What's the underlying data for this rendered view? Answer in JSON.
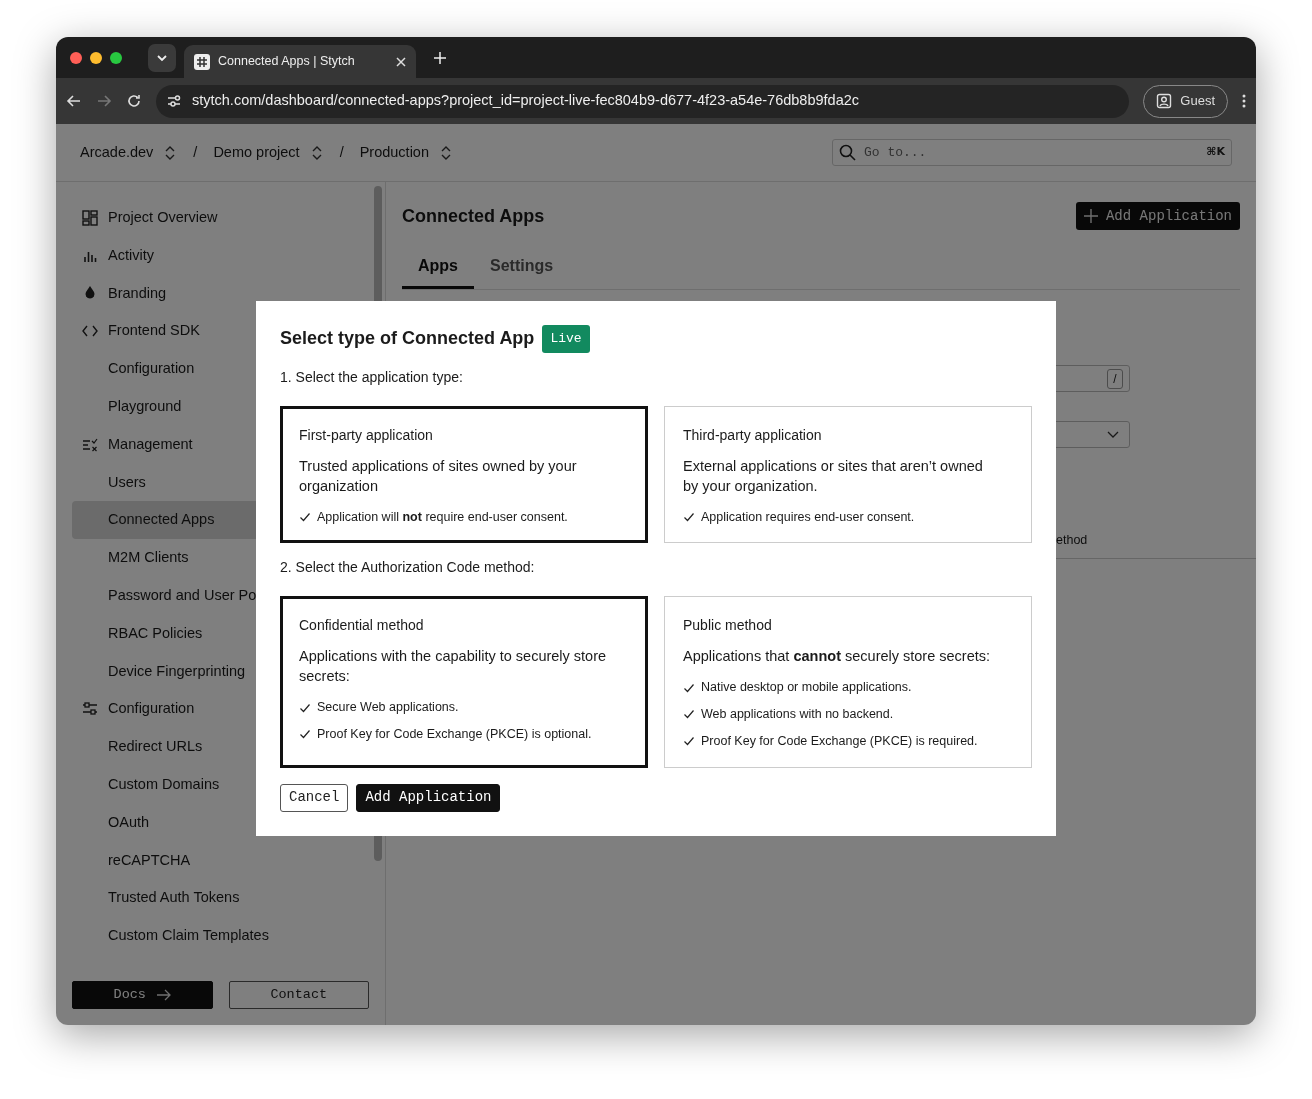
{
  "browser": {
    "tab_title": "Connected Apps | Stytch",
    "url": "stytch.com/dashboard/connected-apps?project_id=project-live-fec804b9-d677-4f23-a54e-76db8b9fda2c",
    "profile": "Guest"
  },
  "header": {
    "breadcrumbs": [
      {
        "kind": "crumb",
        "label": "Arcade.dev"
      },
      {
        "kind": "separator",
        "label": "/"
      },
      {
        "kind": "crumb",
        "label": "Demo project"
      },
      {
        "kind": "separator",
        "label": "/"
      },
      {
        "kind": "crumb",
        "label": "Production"
      }
    ],
    "search": {
      "placeholder": "Go to...",
      "shortcut": "⌘K"
    }
  },
  "sidebar": {
    "items": [
      {
        "kind": "section",
        "label": "Project Overview",
        "selected": false
      },
      {
        "kind": "section",
        "label": "Activity",
        "selected": false
      },
      {
        "kind": "section",
        "label": "Branding",
        "selected": false
      },
      {
        "kind": "section",
        "label": "Frontend SDK",
        "selected": false
      },
      {
        "kind": "sub",
        "label": "Configuration",
        "selected": false
      },
      {
        "kind": "sub",
        "label": "Playground",
        "selected": false
      },
      {
        "kind": "section",
        "label": "Management",
        "selected": false
      },
      {
        "kind": "sub",
        "label": "Users",
        "selected": false
      },
      {
        "kind": "sub",
        "label": "Connected Apps",
        "selected": true
      },
      {
        "kind": "sub",
        "label": "M2M Clients",
        "selected": false
      },
      {
        "kind": "sub",
        "label": "Password and User Po",
        "selected": false
      },
      {
        "kind": "sub",
        "label": "RBAC Policies",
        "selected": false
      },
      {
        "kind": "sub",
        "label": "Device Fingerprinting",
        "selected": false
      },
      {
        "kind": "section",
        "label": "Configuration",
        "selected": false
      },
      {
        "kind": "sub",
        "label": "Redirect URLs",
        "selected": false
      },
      {
        "kind": "sub",
        "label": "Custom Domains",
        "selected": false
      },
      {
        "kind": "sub",
        "label": "OAuth",
        "selected": false
      },
      {
        "kind": "sub",
        "label": "reCAPTCHA",
        "selected": false
      },
      {
        "kind": "sub",
        "label": "Trusted Auth Tokens",
        "selected": false
      },
      {
        "kind": "sub",
        "label": "Custom Claim Templates",
        "selected": false
      }
    ],
    "footer_buttons": [
      {
        "kind": "primary",
        "label": "Docs"
      },
      {
        "kind": "outline",
        "label": "Contact"
      }
    ]
  },
  "main": {
    "title": "Connected Apps",
    "add_button": "Add Application",
    "tabs": [
      {
        "label": "Apps",
        "selected": true
      },
      {
        "label": "Settings",
        "selected": false
      }
    ],
    "filter_shortcut": "/",
    "column_header": "ethod"
  },
  "modal": {
    "title": "Select type of Connected App",
    "badge": "Live",
    "step1": "1. Select the application type:",
    "type_options": [
      {
        "title": "First-party application",
        "description": "Trusted applications of sites owned by your organization",
        "checks": [
          "Application will **not** require end-user consent."
        ],
        "selected": true
      },
      {
        "title": "Third-party application",
        "description": "External applications or sites that aren’t owned by your organization.",
        "checks": [
          "Application requires end-user consent."
        ],
        "selected": false
      }
    ],
    "step2": "2. Select the Authorization Code method:",
    "method_options": [
      {
        "title": "Confidential method",
        "description": "Applications with the capability to securely store secrets:",
        "checks": [
          "Secure Web applications.",
          "Proof Key for Code Exchange (PKCE) is optional."
        ],
        "selected": true
      },
      {
        "title": "Public method",
        "description": "Applications that **cannot** securely store secrets:",
        "checks": [
          "Native desktop or mobile applications.",
          "Web applications with no backend.",
          "Proof Key for Code Exchange (PKCE) is required."
        ],
        "selected": false
      }
    ],
    "buttons": [
      {
        "kind": "outline",
        "label": "Cancel"
      },
      {
        "kind": "primary",
        "label": "Add Application"
      }
    ]
  }
}
